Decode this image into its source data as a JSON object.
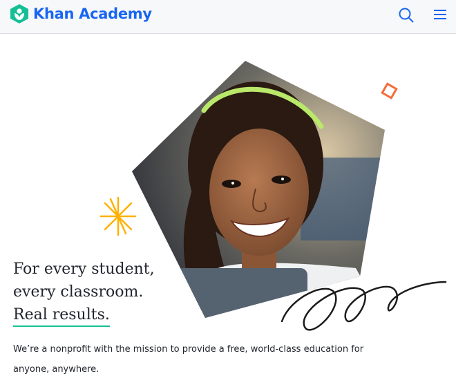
{
  "header": {
    "logo_text": "Khan Academy",
    "logo_icon": "khan-academy-logo-icon",
    "search_icon": "search-icon",
    "menu_icon": "hamburger-menu-icon"
  },
  "hero": {
    "image": "girl-smiling-photo",
    "headline": [
      "For every student,",
      "every classroom.",
      "Real results."
    ],
    "description": "We’re a nonprofit with the mission to provide a free, world-class education for anyone, anywhere."
  },
  "colors": {
    "brand_blue": "#1865f2",
    "brand_green": "#14bf96",
    "accent_orange": "#f56b3a",
    "accent_yellow": "#ffb100"
  }
}
